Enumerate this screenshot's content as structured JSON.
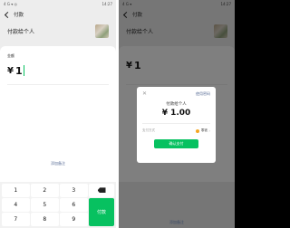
{
  "left": {
    "status": {
      "carrier": "4 G ▾ ◎",
      "time": "14:27"
    },
    "nav_title": "付款",
    "payee_name": "付款给个人",
    "payee_sub": "",
    "amount_label": "金额",
    "currency": "¥",
    "amount": "1",
    "remark_link": "添加备注",
    "keys": [
      "1",
      "2",
      "3",
      "4",
      "5",
      "6",
      "7",
      "8",
      "9"
    ],
    "pay_key": "付款",
    "delete_icon": "backspace-icon"
  },
  "right": {
    "status": {
      "carrier": "4 G ▾",
      "time": "14:27"
    },
    "nav_title": "付款",
    "payee_name": "付款给个人",
    "modal": {
      "close": "✕",
      "use_password": "使用密码",
      "payee": "付款给个人",
      "amount": "¥ 1.00",
      "method_label": "支付方式",
      "method_value": "零钱",
      "confirm": "确认支付"
    },
    "bottom_note": "添加备注"
  },
  "colors": {
    "accent": "#07c160",
    "link": "#576b95"
  }
}
